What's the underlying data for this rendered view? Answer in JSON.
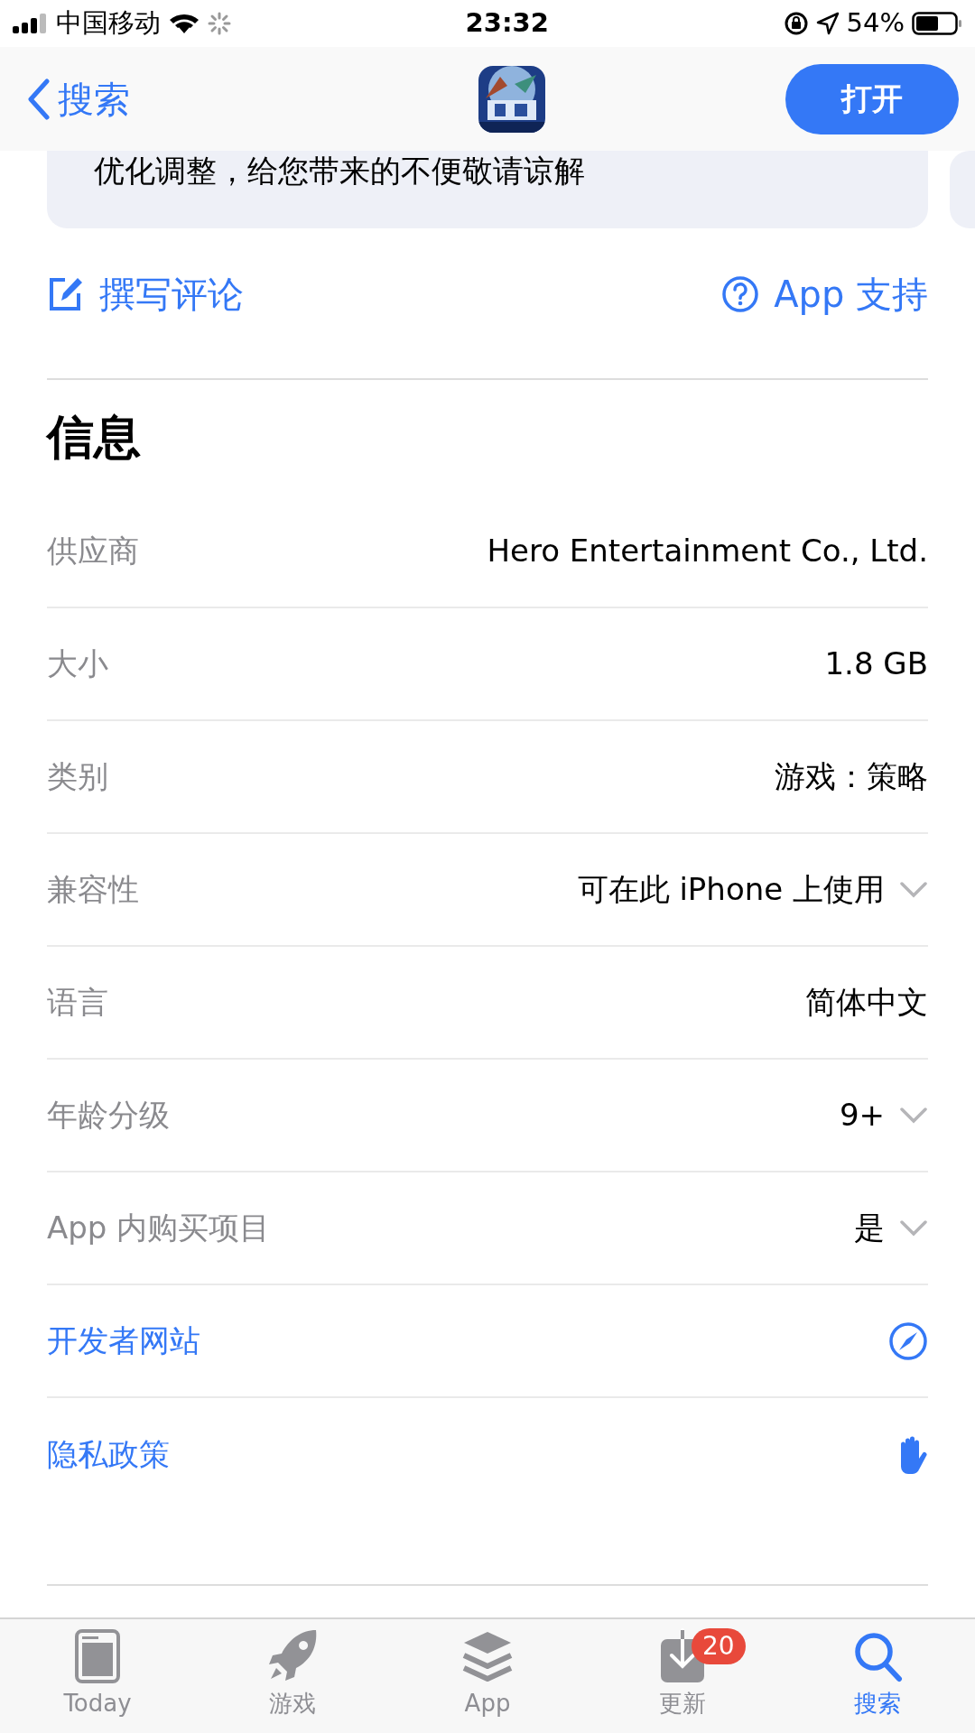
{
  "status_bar": {
    "carrier": "中国移动",
    "time": "23:32",
    "battery": "54%"
  },
  "nav": {
    "back": "搜索",
    "action": "打开"
  },
  "notice": {
    "text": "优化调整，给您带来的不便敬请谅解"
  },
  "actions": [
    {
      "label": "撰写评论"
    },
    {
      "label": "App 支持"
    }
  ],
  "section": {
    "title": "信息"
  },
  "rows": [
    {
      "kind": "info",
      "label": "供应商",
      "value": "Hero Entertainment Co., Ltd.",
      "expandable": false
    },
    {
      "kind": "info",
      "label": "大小",
      "value": "1.8 GB",
      "expandable": false
    },
    {
      "kind": "info",
      "label": "类别",
      "value": "游戏：策略",
      "expandable": false
    },
    {
      "kind": "info",
      "label": "兼容性",
      "value": "可在此 iPhone 上使用",
      "expandable": true
    },
    {
      "kind": "info",
      "label": "语言",
      "value": "简体中文",
      "expandable": false
    },
    {
      "kind": "info",
      "label": "年龄分级",
      "value": "9+",
      "expandable": true
    },
    {
      "kind": "info",
      "label": "App 内购买项目",
      "value": "是",
      "expandable": true
    },
    {
      "kind": "website",
      "label": "开发者网站"
    },
    {
      "kind": "privacy",
      "label": "隐私政策"
    }
  ],
  "tab_bar": [
    {
      "label": "Today",
      "selected": false
    },
    {
      "label": "游戏",
      "selected": false
    },
    {
      "label": "App",
      "selected": false
    },
    {
      "label": "更新",
      "selected": false,
      "badge": "20"
    },
    {
      "label": "搜索",
      "selected": true
    }
  ]
}
